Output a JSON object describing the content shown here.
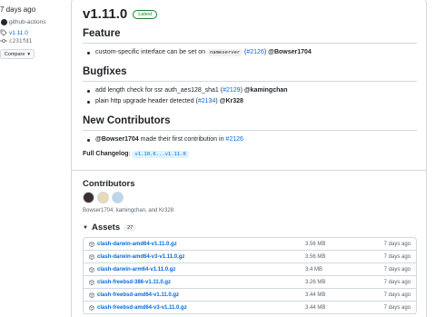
{
  "sidebar": {
    "time_ago": "7 days ago",
    "author": "github-actions",
    "tag": "v1.11.0",
    "commit": "c231fd1",
    "compare_label": "Compare"
  },
  "release": {
    "title": "v1.11.0",
    "badge": "Latest",
    "sections": {
      "feature": {
        "heading": "Feature",
        "item1": {
          "text": "custom-specific interface can be set on",
          "code": "nameserver",
          "link": "#2126",
          "user": "@Bowser1704"
        }
      },
      "bugfixes": {
        "heading": "Bugfixes",
        "item1": {
          "text": "add length check for ssr auth_aes128_sha1",
          "link": "#2129",
          "user": "@kamingchan"
        },
        "item2": {
          "text": "plain http upgrade header detected",
          "link": "#2134",
          "user": "@Kr328"
        }
      },
      "new_contributors": {
        "heading": "New Contributors",
        "item1": {
          "user": "@Bowser1704",
          "text": "made their first contribution in",
          "link": "#2126"
        }
      }
    },
    "changelog": {
      "label": "Full Changelog",
      "link": "v1.10.6...v1.11.0"
    }
  },
  "contributors": {
    "title": "Contributors",
    "names": "Bowser1704, kamingchan, and Kr328",
    "avatar_colors": [
      "#3b2f2f",
      "#e8d9b8",
      "#bcd6e8"
    ]
  },
  "assets": {
    "title": "Assets",
    "count": "27",
    "rows": [
      {
        "name": "clash-darwin-amd64-v1.11.0.gz",
        "size": "3.56 MB",
        "date": "7 days ago"
      },
      {
        "name": "clash-darwin-amd64-v3-v1.11.0.gz",
        "size": "3.56 MB",
        "date": "7 days ago"
      },
      {
        "name": "clash-darwin-arm64-v1.11.0.gz",
        "size": "3.4 MB",
        "date": "7 days ago"
      },
      {
        "name": "clash-freebsd-386-v1.11.0.gz",
        "size": "3.26 MB",
        "date": "7 days ago"
      },
      {
        "name": "clash-freebsd-amd64-v1.11.0.gz",
        "size": "3.44 MB",
        "date": "7 days ago"
      },
      {
        "name": "clash-freebsd-amd64-v3-v1.11.0.gz",
        "size": "3.44 MB",
        "date": "7 days ago"
      }
    ]
  }
}
